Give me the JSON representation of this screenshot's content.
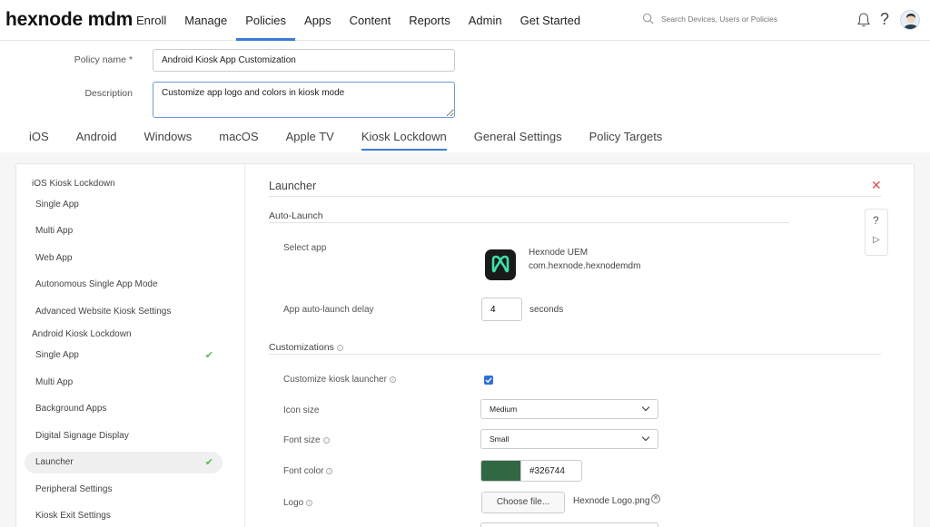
{
  "brand": {
    "logo_text": "hexnode mdm"
  },
  "nav": {
    "items": [
      {
        "label": "Enroll"
      },
      {
        "label": "Manage"
      },
      {
        "label": "Policies"
      },
      {
        "label": "Apps"
      },
      {
        "label": "Content"
      },
      {
        "label": "Reports"
      },
      {
        "label": "Admin"
      },
      {
        "label": "Get Started"
      }
    ],
    "active": "Policies"
  },
  "search": {
    "placeholder": "Search Devices, Users or Policies"
  },
  "policy": {
    "name_label": "Policy name *",
    "name_value": "Android Kiosk App Customization",
    "description_label": "Description",
    "description_value": "Customize app logo and colors in kiosk mode"
  },
  "platform_tabs": [
    {
      "label": "iOS"
    },
    {
      "label": "Android"
    },
    {
      "label": "Windows"
    },
    {
      "label": "macOS"
    },
    {
      "label": "Apple TV"
    },
    {
      "label": "Kiosk Lockdown"
    },
    {
      "label": "General Settings"
    },
    {
      "label": "Policy Targets"
    }
  ],
  "active_tab": "Kiosk Lockdown",
  "sidebar": {
    "ios_header": "iOS Kiosk Lockdown",
    "ios_items": [
      {
        "label": "Single App"
      },
      {
        "label": "Multi App"
      },
      {
        "label": "Web App"
      },
      {
        "label": "Autonomous Single App Mode"
      },
      {
        "label": "Advanced Website Kiosk Settings"
      }
    ],
    "android_header": "Android Kiosk Lockdown",
    "android_items": [
      {
        "label": "Single App",
        "configured": true
      },
      {
        "label": "Multi App"
      },
      {
        "label": "Background Apps"
      },
      {
        "label": "Digital Signage Display"
      },
      {
        "label": "Launcher",
        "configured": true
      },
      {
        "label": "Peripheral Settings"
      },
      {
        "label": "Kiosk Exit Settings"
      }
    ],
    "active_item": "Launcher"
  },
  "launcher": {
    "title": "Launcher",
    "auto_launch": {
      "title": "Auto-Launch",
      "select_app_label": "Select app",
      "app_name": "Hexnode UEM",
      "app_package": "com.hexnode.hexnodemdm",
      "delay_label": "App auto-launch delay",
      "delay_value": "4",
      "delay_unit": "seconds"
    },
    "customizations": {
      "title": "Customizations",
      "customize_label": "Customize kiosk launcher",
      "customize_checked": true,
      "icon_size_label": "Icon size",
      "icon_size_value": "Medium",
      "font_size_label": "Font size",
      "font_size_value": "Small",
      "font_color_label": "Font color",
      "font_color_value": "#326744",
      "logo_label": "Logo",
      "choose_file_label": "Choose file...",
      "logo_file": "Hexnode Logo.png"
    }
  },
  "colors": {
    "accent": "#3a7bd5",
    "font_color_swatch": "#326744",
    "check_green": "#5cb85c",
    "close_red": "#d9534f"
  }
}
